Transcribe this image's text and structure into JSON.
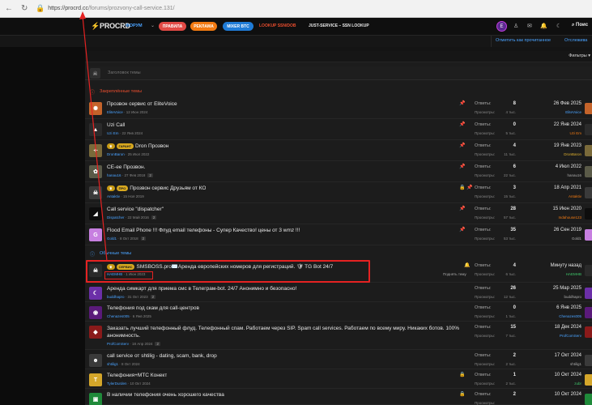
{
  "browser": {
    "back_icon": "back-arrow-icon",
    "url_host": "https://procrd.cc",
    "url_path": "/forums/prozvony-call-service.131/"
  },
  "header": {
    "logo_mark": "⚡",
    "logo_text": "PROCRD",
    "nav_forum": "ФОРУМ",
    "pill_rules": "ПРАВИЛА",
    "pill_ads": "РЕКЛАМА",
    "pill_mixer": "MIXER BTC",
    "link_lookup": "LOOKUP SSN/DOB",
    "link_just": "JUST-SERVICE – SSN LOOKUP",
    "avatar_letter": "E",
    "search_label": "Поис"
  },
  "subheader": {
    "mark_read": "Отметить как прочитанное",
    "watch": "Отслежива"
  },
  "filterbar": {
    "label": "Фильтры ▾"
  },
  "title_input": {
    "placeholder": "Заголовок темы"
  },
  "sections": {
    "sticky": "Закреплённые темы",
    "normal": "Обычные темы"
  },
  "labels": {
    "replies": "Ответы:",
    "views": "Просмотры:"
  },
  "sticky_threads": [
    {
      "title": "Прозвон сервис от EliteVoice",
      "author": "EliteVoice",
      "date": "12 Июн 2024",
      "pages": "",
      "replies": "8",
      "views": "4 тыс.",
      "last_date": "26 Фев 2025",
      "last_user": "EliteVoice",
      "last_color": "h-blu",
      "av_color": "#c4632a",
      "av_text": "✺",
      "prefix": "",
      "icons": "📌"
    },
    {
      "title": "Uzi Call",
      "author": "Uzi Em",
      "date": "22 Янв 2024",
      "pages": "",
      "replies": "0",
      "views": "5 тыс.",
      "last_date": "22 Янв 2024",
      "last_user": "Uzi Em",
      "last_color": "h-org",
      "av_color": "#2b2b2b",
      "av_text": "▲",
      "prefix": "",
      "icons": "📌"
    },
    {
      "title": "Dron Прозвон",
      "author": "DronBaron",
      "date": "25 Июл 2022",
      "pages": "",
      "replies": "4",
      "views": "11 тыс.",
      "last_date": "19 Янв 2023",
      "last_user": "DronBaron",
      "last_color": "h-gld",
      "av_color": "#7a6a3a",
      "av_text": "✦",
      "prefix": "ГАРАНТ",
      "icons": "📌"
    },
    {
      "title": "CE-ee Прозвон.",
      "author": "hanau16",
      "date": "27 Фев 2018",
      "pages": "2",
      "replies": "6",
      "views": "22 тыс.",
      "last_date": "4 Июл 2022",
      "last_user": "hanau16",
      "last_color": "h-gry",
      "av_color": "#5a5a48",
      "av_text": "✿",
      "prefix": "",
      "icons": "📌"
    },
    {
      "title": "Прозвон сервис Друзьям от КО",
      "author": "Antaktiv",
      "date": "15 Ноя 2019",
      "pages": "",
      "replies": "3",
      "views": "15 тыс.",
      "last_date": "18 Апр 2021",
      "last_user": "Antaktiv",
      "last_color": "h-org",
      "av_color": "#3a3a3a",
      "av_text": "☠",
      "prefix": "ПРО",
      "icons": "🔒 📌"
    },
    {
      "title": "Call service \"dispatcher\"",
      "author": "Dispatcher",
      "date": "22 Май 2016",
      "pages": "2",
      "replies": "28",
      "views": "57 тыс.",
      "last_date": "15 Июн 2020",
      "last_user": "Indahouse123",
      "last_color": "h-org",
      "av_color": "#0d0d0d",
      "av_text": "◢",
      "prefix": "",
      "icons": "📌"
    },
    {
      "title": "Flood Email Phone !!! Флуд email телефоны - Супер Качество! цены от 3 wmz !!!",
      "author": "Gold1",
      "date": "8 Окт 2018",
      "pages": "2",
      "replies": "35",
      "views": "53 тыс.",
      "last_date": "26 Сен 2019",
      "last_user": "Gold1",
      "last_color": "h-gry",
      "av_color": "#c77fe0",
      "av_text": "G",
      "prefix": "",
      "icons": "📌"
    }
  ],
  "normal_threads": [
    {
      "title": "SMSBOSS.pro✉️Аренда европейских номеров для регистраций. 🛡 TG Bot 24/7",
      "author": "HAEMHB",
      "date": "1 Июн 2023",
      "pages": "",
      "replies": "4",
      "views": "6 тыс.",
      "last_date": "Минуту назад",
      "last_user": "HAEMHB",
      "last_color": "h-grn",
      "av_color": "#2a2a2a",
      "av_text": "☠",
      "prefix": "СЕРВИС",
      "icons": "🔔",
      "extra": "Поднять тему"
    },
    {
      "title": "Аренда симкарт для приема смс в Телеграм-bot. 24/7 Анонимно и безопасно!",
      "author": "buddhapro",
      "date": "31 Окт 2023",
      "pages": "2",
      "replies": "26",
      "views": "12 тыс.",
      "last_date": "25 Мар 2025",
      "last_user": "buddhapro",
      "last_color": "h-gry",
      "av_color": "#6b2fa8",
      "av_text": "☾",
      "prefix": "",
      "icons": ""
    },
    {
      "title": "Телефония под скам для call-центров",
      "author": "Chenazes005",
      "date": "6 Янв 2025",
      "pages": "",
      "replies": "0",
      "views": "1 тыс.",
      "last_date": "6 Янв 2025",
      "last_user": "Chenazes005",
      "last_color": "h-blu",
      "av_color": "#5a1a7a",
      "av_text": "◉",
      "prefix": "",
      "icons": ""
    },
    {
      "title": "Заказать лучший телефонный флуд. Телефонный спам. Работаем через SIP. Spam call services. Работаем по всему миру. Никаких ботов. 100% анонимность.",
      "author": "ProfComServ",
      "date": "18 Апр 2024",
      "pages": "2",
      "replies": "15",
      "views": "7 тыс.",
      "last_date": "18 Дек 2024",
      "last_user": "ProfComServ",
      "last_color": "h-blu",
      "av_color": "#8a1a1a",
      "av_text": "◆",
      "prefix": "",
      "icons": ""
    },
    {
      "title": "call service от shtilig - dating, scam, bank, drop",
      "author": "shtilig1",
      "date": "8 Окт 2024",
      "pages": "",
      "replies": "2",
      "views": "2 тыс.",
      "last_date": "17 Окт 2024",
      "last_user": "shtilig1",
      "last_color": "h-gry",
      "av_color": "#3a3a3a",
      "av_text": "☻",
      "prefix": "",
      "icons": ""
    },
    {
      "title": "Телефония+МТС Конект",
      "author": "TylerDurden",
      "date": "10 Окт 2024",
      "pages": "",
      "replies": "1",
      "views": "2 тыс.",
      "last_date": "10 Окт 2024",
      "last_user": "zubr",
      "last_color": "h-grn",
      "av_color": "#d4a62a",
      "av_text": "T",
      "prefix": "",
      "icons": "🔒"
    },
    {
      "title": "В наличии телефония очень хорошего качества",
      "author": "",
      "date": "",
      "pages": "",
      "replies": "2",
      "views": "",
      "last_date": "10 Окт 2024",
      "last_user": "",
      "last_color": "h-gry",
      "av_color": "#1f8a3a",
      "av_text": "▣",
      "prefix": "",
      "icons": "🔒"
    }
  ]
}
